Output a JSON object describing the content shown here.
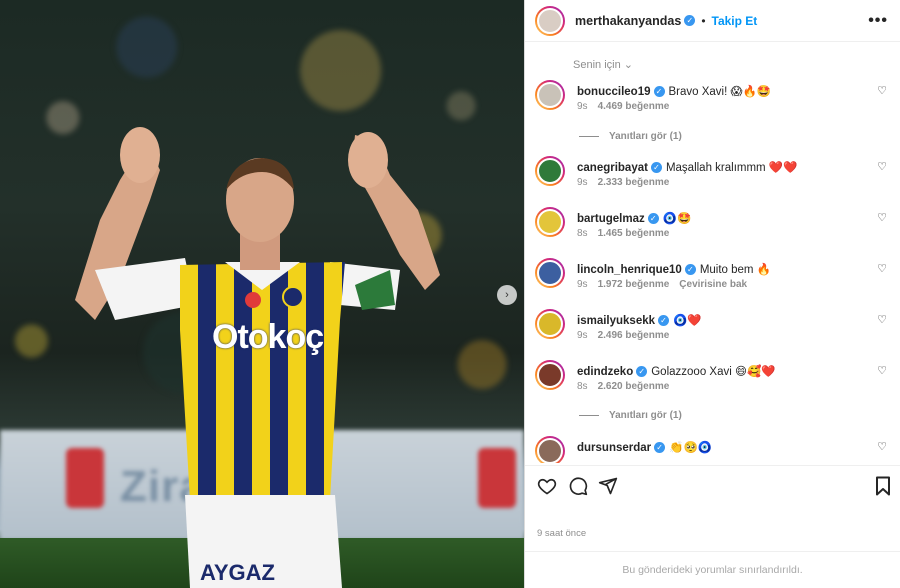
{
  "post": {
    "author": "merthakanyandas",
    "follow_label": "Takip Et",
    "separator": "•",
    "more_glyph": "•••",
    "time_ago": "9 saat önce",
    "restricted_notice": "Bu gönderideki yorumlar sınırlandırıldı.",
    "photo": {
      "board_text": "Zira   ası",
      "sponsor_text": "Otokoç",
      "shorts_text": "AYGAZ"
    }
  },
  "comments_filter": {
    "label": "Senin için",
    "chevron": "⌄"
  },
  "comments": [
    {
      "user": "bonucci​leo19",
      "text": "Bravo Xavi! 😱🔥🤩",
      "age": "9s",
      "likes": "4.469 beğenme",
      "extra": "",
      "avatar_color": "#c9c2b8",
      "replies": "Yanıtları gör (1)"
    },
    {
      "user": "canegribayat",
      "text": "Maşallah kralımmm ❤️❤️",
      "age": "9s",
      "likes": "2.333 beğenme",
      "extra": "",
      "avatar_color": "#2f7a3a",
      "replies": ""
    },
    {
      "user": "bartugelmaz",
      "text": "🧿🤩",
      "age": "8s",
      "likes": "1.465 beğenme",
      "extra": "",
      "avatar_color": "#e3c53a",
      "replies": ""
    },
    {
      "user": "lincoln_henrique10",
      "text": "Muito bem 🔥",
      "age": "9s",
      "likes": "1.972 beğenme",
      "extra": "Çevirisine bak",
      "avatar_color": "#3c5fa0",
      "replies": ""
    },
    {
      "user": "ismailyuksekk",
      "text": "🧿❤️",
      "age": "9s",
      "likes": "2.496 beğenme",
      "extra": "",
      "avatar_color": "#d9b82a",
      "replies": ""
    },
    {
      "user": "edindzeko",
      "text": "Golazzooo Xavi 😄🥰❤️",
      "age": "8s",
      "likes": "2.620 beğenme",
      "extra": "",
      "avatar_color": "#7a3a2a",
      "replies": "Yanıtları gör (1)"
    },
    {
      "user": "dursunserdar",
      "text": "👏🥺🧿",
      "age": "",
      "likes": "",
      "extra": "",
      "avatar_color": "#8a6a5a",
      "replies": ""
    }
  ],
  "icons": {
    "verified": "✓",
    "heart": "♡",
    "carousel_next": "›"
  },
  "colors": {
    "accent": "#0095f6",
    "verified": "#3897f0",
    "jersey_navy": "#1b2a6b",
    "jersey_yellow": "#f2d21a"
  }
}
